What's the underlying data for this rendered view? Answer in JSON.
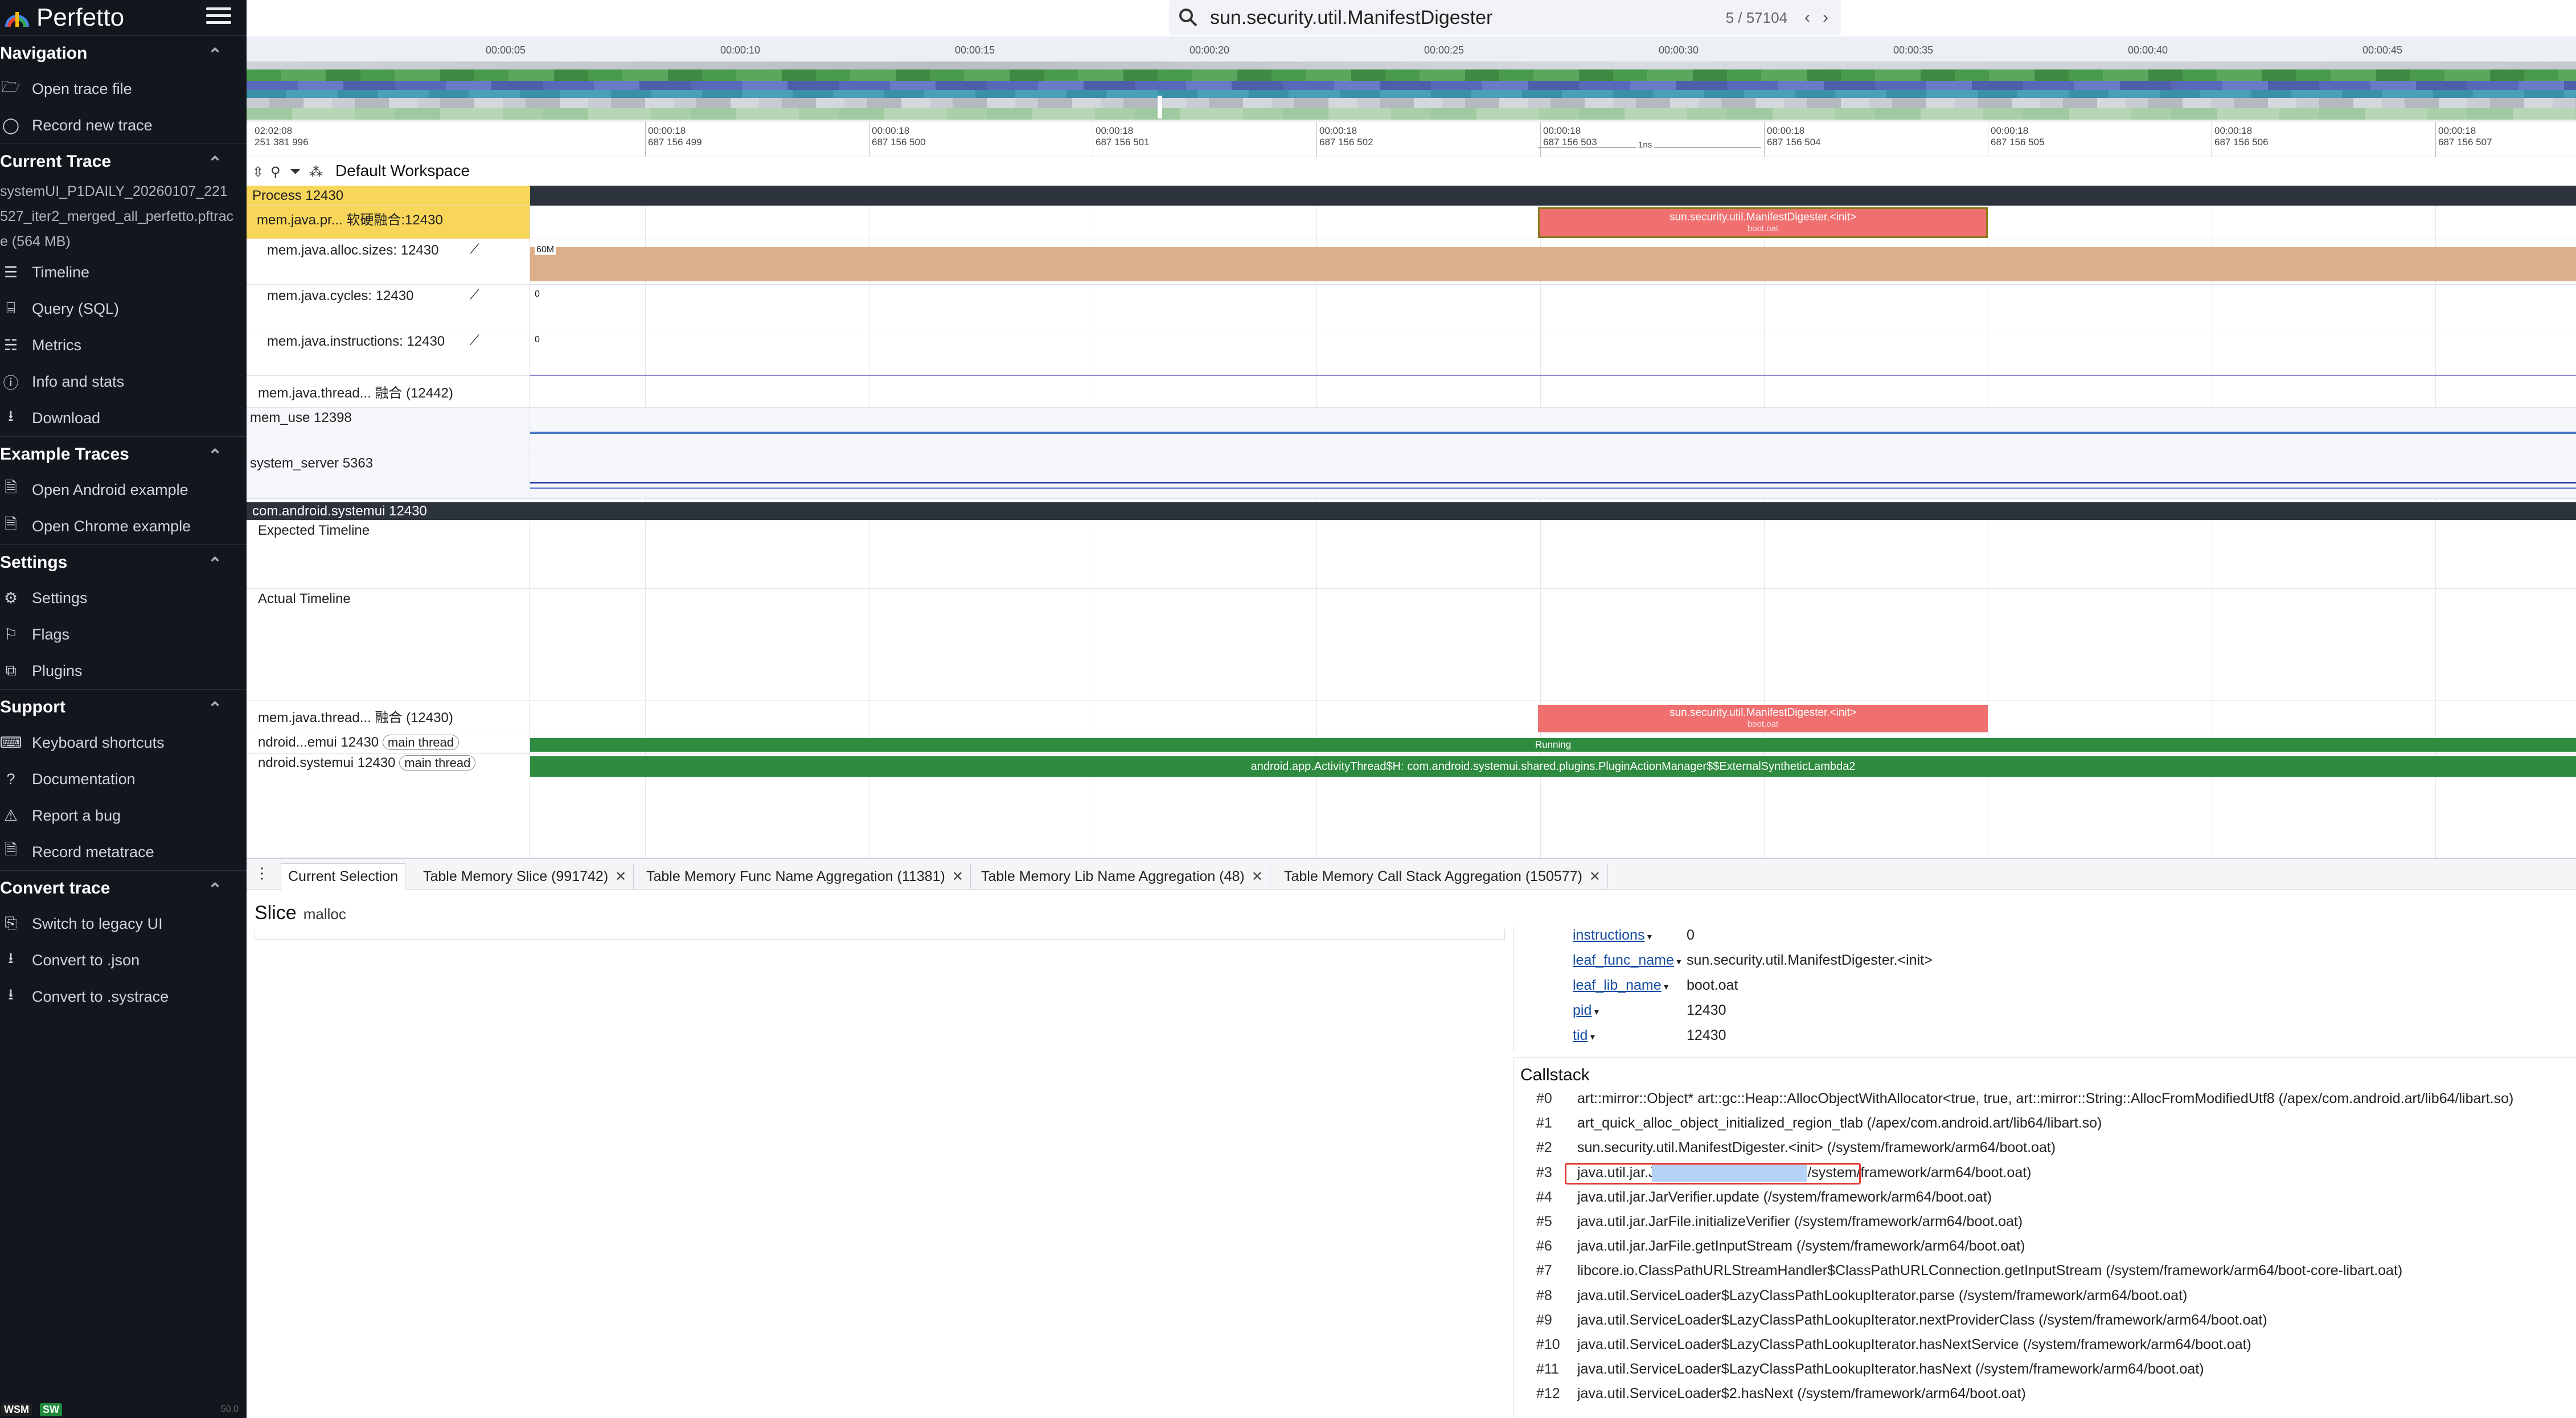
{
  "app": {
    "name": "Perfetto"
  },
  "search": {
    "query": "sun.security.util.ManifestDigester",
    "count": "5 / 57104"
  },
  "sidebar": {
    "sections": [
      {
        "title": "Navigation",
        "items": [
          {
            "icon": "folder-open-icon",
            "label": "Open trace file"
          },
          {
            "icon": "record-icon",
            "label": "Record new trace"
          }
        ]
      },
      {
        "title": "Current Trace",
        "trace_name": "systemUI_P1DAILY_20260107_221527_iter2_merged_all_perfetto.pftrace (564 MB)",
        "items": [
          {
            "icon": "timeline-icon",
            "label": "Timeline"
          },
          {
            "icon": "query-icon",
            "label": "Query (SQL)"
          },
          {
            "icon": "metrics-icon",
            "label": "Metrics"
          },
          {
            "icon": "info-icon",
            "label": "Info and stats"
          },
          {
            "icon": "download-icon",
            "label": "Download"
          }
        ]
      },
      {
        "title": "Example Traces",
        "items": [
          {
            "icon": "document-icon",
            "label": "Open Android example"
          },
          {
            "icon": "document-icon",
            "label": "Open Chrome example"
          }
        ]
      },
      {
        "title": "Settings",
        "items": [
          {
            "icon": "gear-icon",
            "label": "Settings"
          },
          {
            "icon": "flag-icon",
            "label": "Flags"
          },
          {
            "icon": "plugin-icon",
            "label": "Plugins"
          }
        ]
      },
      {
        "title": "Support",
        "items": [
          {
            "icon": "keyboard-icon",
            "label": "Keyboard shortcuts"
          },
          {
            "icon": "book-icon",
            "label": "Documentation"
          },
          {
            "icon": "bug-icon",
            "label": "Report a bug"
          },
          {
            "icon": "document-icon",
            "label": "Record metatrace"
          }
        ]
      },
      {
        "title": "Convert trace",
        "items": [
          {
            "icon": "switch-icon",
            "label": "Switch to legacy UI"
          },
          {
            "icon": "download-icon",
            "label": "Convert to .json"
          },
          {
            "icon": "download-icon",
            "label": "Convert to .systrace"
          }
        ]
      }
    ],
    "footer": {
      "wsm": "WSM",
      "sw": "SW",
      "version": "50.0"
    }
  },
  "overview": {
    "ticks": [
      "00:00:05",
      "00:00:10",
      "00:00:15",
      "00:00:20",
      "00:00:25",
      "00:00:30",
      "00:00:35",
      "00:00:40",
      "00:00:45"
    ]
  },
  "ruler": {
    "origin": [
      "02:02:08",
      "251 381 996"
    ],
    "ticks": [
      [
        "00:00:18",
        "687 156 499"
      ],
      [
        "00:00:18",
        "687 156 500"
      ],
      [
        "00:00:18",
        "687 156 501"
      ],
      [
        "00:00:18",
        "687 156 502"
      ],
      [
        "00:00:18",
        "687 156 503"
      ],
      [
        "00:00:18",
        "687 156 504"
      ],
      [
        "00:00:18",
        "687 156 505"
      ],
      [
        "00:00:18",
        "687 156 506"
      ],
      [
        "00:00:18",
        "687 156 507"
      ]
    ],
    "span_label": "1ns"
  },
  "workspace": {
    "name": "Default Workspace"
  },
  "tracks": {
    "process_header": "Process 12430",
    "heap_track": "mem.java.pr... 软硬融合:12430",
    "counter1": "mem.java.alloc.sizes: 12430",
    "counter1_value": "60M",
    "counter2": "mem.java.cycles: 12430",
    "counter2_value": "0",
    "counter3": "mem.java.instructions: 12430",
    "counter3_value": "0",
    "thread_track": "mem.java.thread... 融合 (12442)",
    "mem_use": "mem_use 12398",
    "system_server": "system_server 5363",
    "systemui_header": "com.android.systemui 12430",
    "expected": "Expected Timeline",
    "actual": "Actual Timeline",
    "thread_track2": "mem.java.thread... 融合 (12430)",
    "main1": "ndroid...emui 12430",
    "main2": "ndroid.systemui 12430",
    "main_tag": "main thread",
    "slice_name": "sun.security.util.ManifestDigester.<init>",
    "slice_sub": "boot.oat",
    "running": "Running",
    "long_slice": "android.app.ActivityThread$H: com.android.systemui.shared.plugins.PluginActionManager$$ExternalSyntheticLambda2"
  },
  "panel": {
    "tabs": [
      {
        "label": "Current Selection",
        "closable": false
      },
      {
        "label": "Table Memory Slice (991742)",
        "closable": true
      },
      {
        "label": "Table Memory Func Name Aggregation (11381)",
        "closable": true
      },
      {
        "label": "Table Memory Lib Name Aggregation (48)",
        "closable": true
      },
      {
        "label": "Table Memory Call Stack Aggregation (150577)",
        "closable": true
      }
    ],
    "slice_title": "Slice",
    "slice_sub": "malloc",
    "args": [
      {
        "k": "instructions",
        "v": "0"
      },
      {
        "k": "leaf_func_name",
        "v": "sun.security.util.ManifestDigester.<init>"
      },
      {
        "k": "leaf_lib_name",
        "v": "boot.oat"
      },
      {
        "k": "pid",
        "v": "12430"
      },
      {
        "k": "tid",
        "v": "12430"
      }
    ],
    "callstack_title": "Callstack",
    "callstack": [
      {
        "n": "#0",
        "f": "art::mirror::Object* art::gc::Heap::AllocObjectWithAllocator<true, true, art::mirror::String::AllocFromModifiedUtf8 (/apex/com.android.art/lib64/libart.so)"
      },
      {
        "n": "#1",
        "f": "art_quick_alloc_object_initialized_region_tlab (/apex/com.android.art/lib64/libart.so)"
      },
      {
        "n": "#2",
        "f": "sun.security.util.ManifestDigester.<init> (/system/framework/arm64/boot.oat)"
      },
      {
        "n": "#3",
        "f": "java.util.jar.JarVerifier.processEntry (/system/framework/arm64/boot.oat)"
      },
      {
        "n": "#4",
        "f": "java.util.jar.JarVerifier.update (/system/framework/arm64/boot.oat)"
      },
      {
        "n": "#5",
        "f": "java.util.jar.JarFile.initializeVerifier (/system/framework/arm64/boot.oat)"
      },
      {
        "n": "#6",
        "f": "java.util.jar.JarFile.getInputStream (/system/framework/arm64/boot.oat)"
      },
      {
        "n": "#7",
        "f": "libcore.io.ClassPathURLStreamHandler$ClassPathURLConnection.getInputStream (/system/framework/arm64/boot-core-libart.oat)"
      },
      {
        "n": "#8",
        "f": "java.util.ServiceLoader$LazyClassPathLookupIterator.parse (/system/framework/arm64/boot.oat)"
      },
      {
        "n": "#9",
        "f": "java.util.ServiceLoader$LazyClassPathLookupIterator.nextProviderClass (/system/framework/arm64/boot.oat)"
      },
      {
        "n": "#10",
        "f": "java.util.ServiceLoader$LazyClassPathLookupIterator.hasNextService (/system/framework/arm64/boot.oat)"
      },
      {
        "n": "#11",
        "f": "java.util.ServiceLoader$LazyClassPathLookupIterator.hasNext (/system/framework/arm64/boot.oat)"
      },
      {
        "n": "#12",
        "f": "java.util.ServiceLoader$2.hasNext (/system/framework/arm64/boot.oat)"
      }
    ]
  },
  "colors": {
    "slice": "#f07070",
    "running": "#2e8b3f",
    "heap_highlight": "#f8d65a",
    "counter_fill": "#dcae89"
  }
}
